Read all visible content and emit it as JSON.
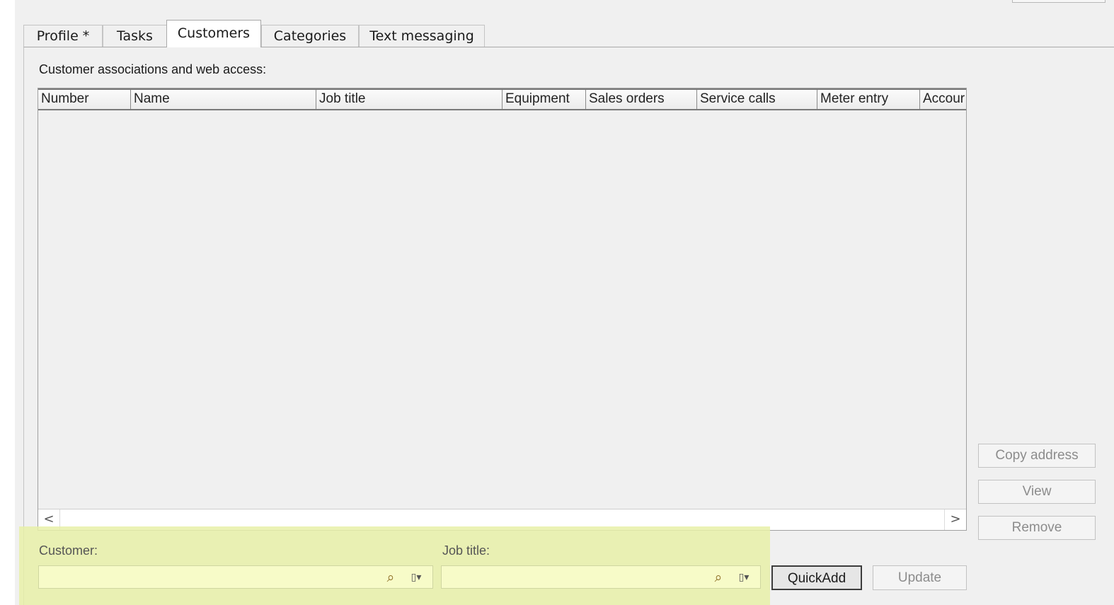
{
  "tabs": [
    {
      "label": "Profile *",
      "active": false
    },
    {
      "label": "Tasks",
      "active": false
    },
    {
      "label": "Customers",
      "active": true
    },
    {
      "label": "Categories",
      "active": false
    },
    {
      "label": "Text messaging",
      "active": false
    }
  ],
  "section": {
    "label": "Customer associations and web access:"
  },
  "grid": {
    "columns": [
      "Number",
      "Name",
      "Job title",
      "Equipment",
      "Sales orders",
      "Service calls",
      "Meter entry",
      "Accour"
    ],
    "rows": [],
    "scroll_left": "<",
    "scroll_right": ">"
  },
  "side_buttons": {
    "copy_address": "Copy address",
    "view": "View",
    "remove": "Remove"
  },
  "form": {
    "customer_label": "Customer:",
    "customer_value": "",
    "job_title_label": "Job title:",
    "job_title_value": "",
    "quickadd": "QuickAdd",
    "update": "Update"
  },
  "icons": {
    "search": "magnifier-icon",
    "menu": "lookup-menu-icon"
  },
  "colors": {
    "highlight": "#e8f0a8",
    "panel": "#f0f0f0"
  }
}
